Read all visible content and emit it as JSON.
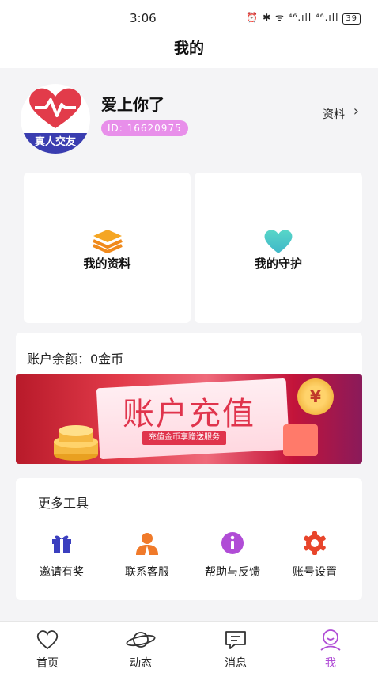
{
  "status": {
    "time": "3:06",
    "icons": "⏰ ✱ ᯤ ⁴⁶.ıll ⁴⁶.ıll",
    "battery": "39"
  },
  "header": {
    "title": "我的"
  },
  "profile": {
    "avatar_label": "真人交友",
    "name": "爱上你了",
    "id": "ID: 16620975",
    "link_label": "资料",
    "chevron": "›"
  },
  "quick": [
    {
      "label": "我的资料",
      "icon": "layers-icon",
      "color": "#f08a1c"
    },
    {
      "label": "我的守护",
      "icon": "heart-icon",
      "color": "#45d0c0"
    }
  ],
  "balance": {
    "text": "账户余额：0金币"
  },
  "banner": {
    "title": "账户充值",
    "subtitle": "充值金币享赠送服务",
    "coin_symbol": "¥"
  },
  "tools": {
    "title": "更多工具",
    "items": [
      {
        "label": "邀请有奖",
        "icon": "gift-icon",
        "color": "#3b3fbf"
      },
      {
        "label": "联系客服",
        "icon": "customer-service-icon",
        "color": "#f07a2a"
      },
      {
        "label": "帮助与反馈",
        "icon": "info-icon",
        "color": "#b04cd6"
      },
      {
        "label": "账号设置",
        "icon": "gear-icon",
        "color": "#e8452b"
      }
    ]
  },
  "tabs": [
    {
      "label": "首页",
      "icon": "heart-outline-icon"
    },
    {
      "label": "动态",
      "icon": "planet-icon"
    },
    {
      "label": "消息",
      "icon": "message-icon"
    },
    {
      "label": "我",
      "icon": "user-icon",
      "active": true
    }
  ],
  "colors": {
    "accent": "#b04cd6",
    "id_badge": "#e88fea",
    "brand_red": "#e0344c"
  }
}
